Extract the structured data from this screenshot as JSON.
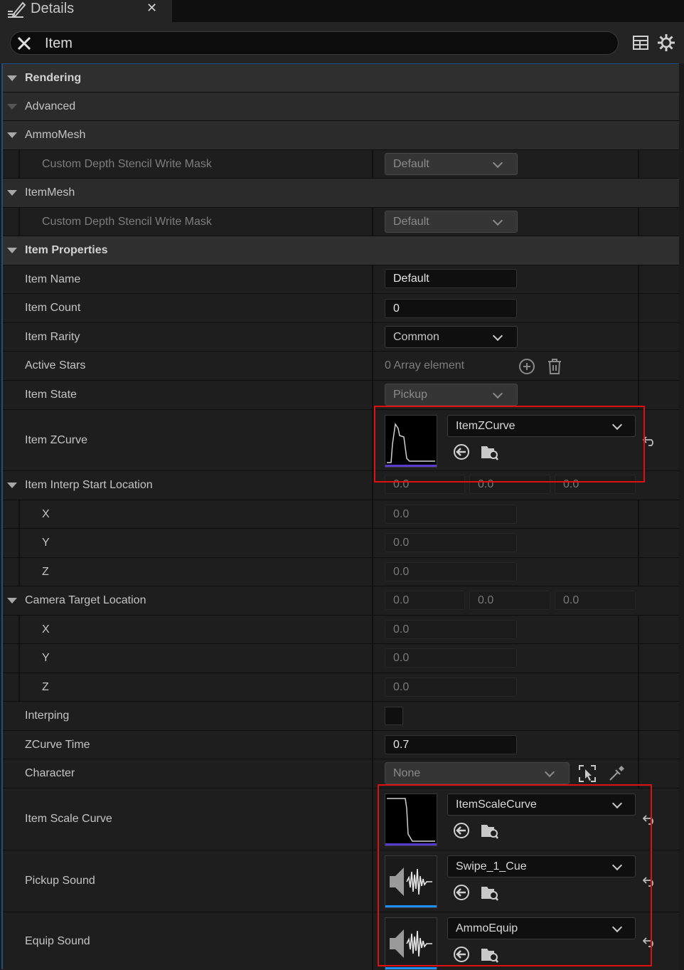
{
  "tab": {
    "title": "Details",
    "close_glyph": "✕"
  },
  "search": {
    "value": "Item"
  },
  "categories": {
    "rendering": "Rendering",
    "advanced": "Advanced",
    "ammo_mesh": "AmmoMesh",
    "item_mesh": "ItemMesh",
    "item_properties": "Item Properties"
  },
  "rendering": {
    "ammo_mesh_stencil": {
      "label": "Custom Depth Stencil Write Mask",
      "value": "Default"
    },
    "item_mesh_stencil": {
      "label": "Custom Depth Stencil Write Mask",
      "value": "Default"
    }
  },
  "props": {
    "item_name": {
      "label": "Item Name",
      "value": "Default"
    },
    "item_count": {
      "label": "Item Count",
      "value": "0"
    },
    "item_rarity": {
      "label": "Item Rarity",
      "value": "Common"
    },
    "active_stars": {
      "label": "Active Stars",
      "value": "0 Array element"
    },
    "item_state": {
      "label": "Item State",
      "value": "Pickup"
    },
    "item_zcurve": {
      "label": "Item ZCurve",
      "asset": "ItemZCurve"
    },
    "interp_start": {
      "label": "Item Interp Start Location",
      "x": "0.0",
      "y": "0.0",
      "z": "0.0",
      "x_label": "X",
      "y_label": "Y",
      "z_label": "Z"
    },
    "camera_target": {
      "label": "Camera Target Location",
      "x": "0.0",
      "y": "0.0",
      "z": "0.0",
      "x_label": "X",
      "y_label": "Y",
      "z_label": "Z"
    },
    "interping": {
      "label": "Interping",
      "checked": false
    },
    "zcurve_time": {
      "label": "ZCurve Time",
      "value": "0.7"
    },
    "character": {
      "label": "Character",
      "value": "None"
    },
    "item_scale_curve": {
      "label": "Item Scale Curve",
      "asset": "ItemScaleCurve"
    },
    "pickup_sound": {
      "label": "Pickup Sound",
      "asset": "Swipe_1_Cue"
    },
    "equip_sound": {
      "label": "Equip Sound",
      "asset": "AmmoEquip"
    }
  },
  "colors": {
    "highlight": "#e01010",
    "curve_bar": "#5a3ccc",
    "sound_bar": "#1e90ff",
    "panel_border": "#1f4d8a"
  },
  "icons": [
    "edit-details-icon",
    "close-icon",
    "clear-search-icon",
    "table-view-icon",
    "settings-gear-icon",
    "add-element-icon",
    "delete-all-icon",
    "use-selected-icon",
    "browse-asset-icon",
    "reset-to-default-icon",
    "pick-actor-icon",
    "eyedropper-icon",
    "dropdown-chevron-icon",
    "expand-arrow-icon"
  ]
}
